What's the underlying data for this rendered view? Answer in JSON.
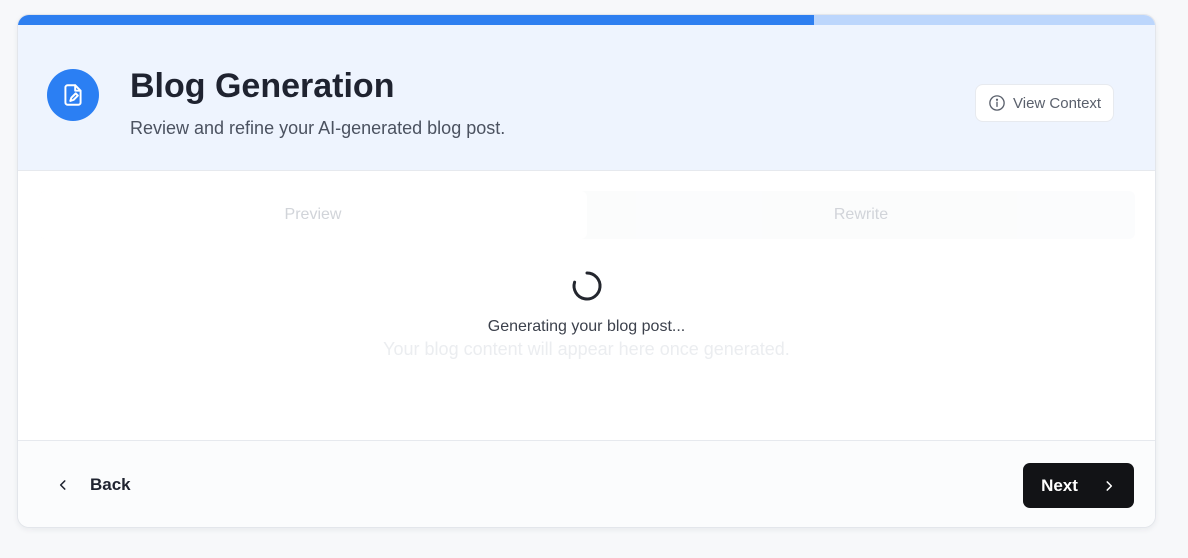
{
  "progress": {
    "fraction": 0.7
  },
  "header": {
    "icon": "document-edit-icon",
    "title": "Blog Generation",
    "subtitle": "Review and refine your AI-generated blog post.",
    "view_context_label": "View Context",
    "view_context_icon": "info-icon"
  },
  "tabs": [
    {
      "label": "Preview",
      "active": true
    },
    {
      "label": "Rewrite",
      "active": false
    }
  ],
  "loading": {
    "icon": "spinner-icon",
    "message": "Generating your blog post...",
    "placeholder": "Your blog content will appear here once generated."
  },
  "footer": {
    "back_label": "Back",
    "back_icon": "chevron-left-icon",
    "next_label": "Next",
    "next_icon": "chevron-right-icon"
  },
  "colors": {
    "accent": "#2b7ff3",
    "progress_track": "#bcd6fc",
    "header_bg": "#eef4fe",
    "next_button_bg": "#121316"
  }
}
